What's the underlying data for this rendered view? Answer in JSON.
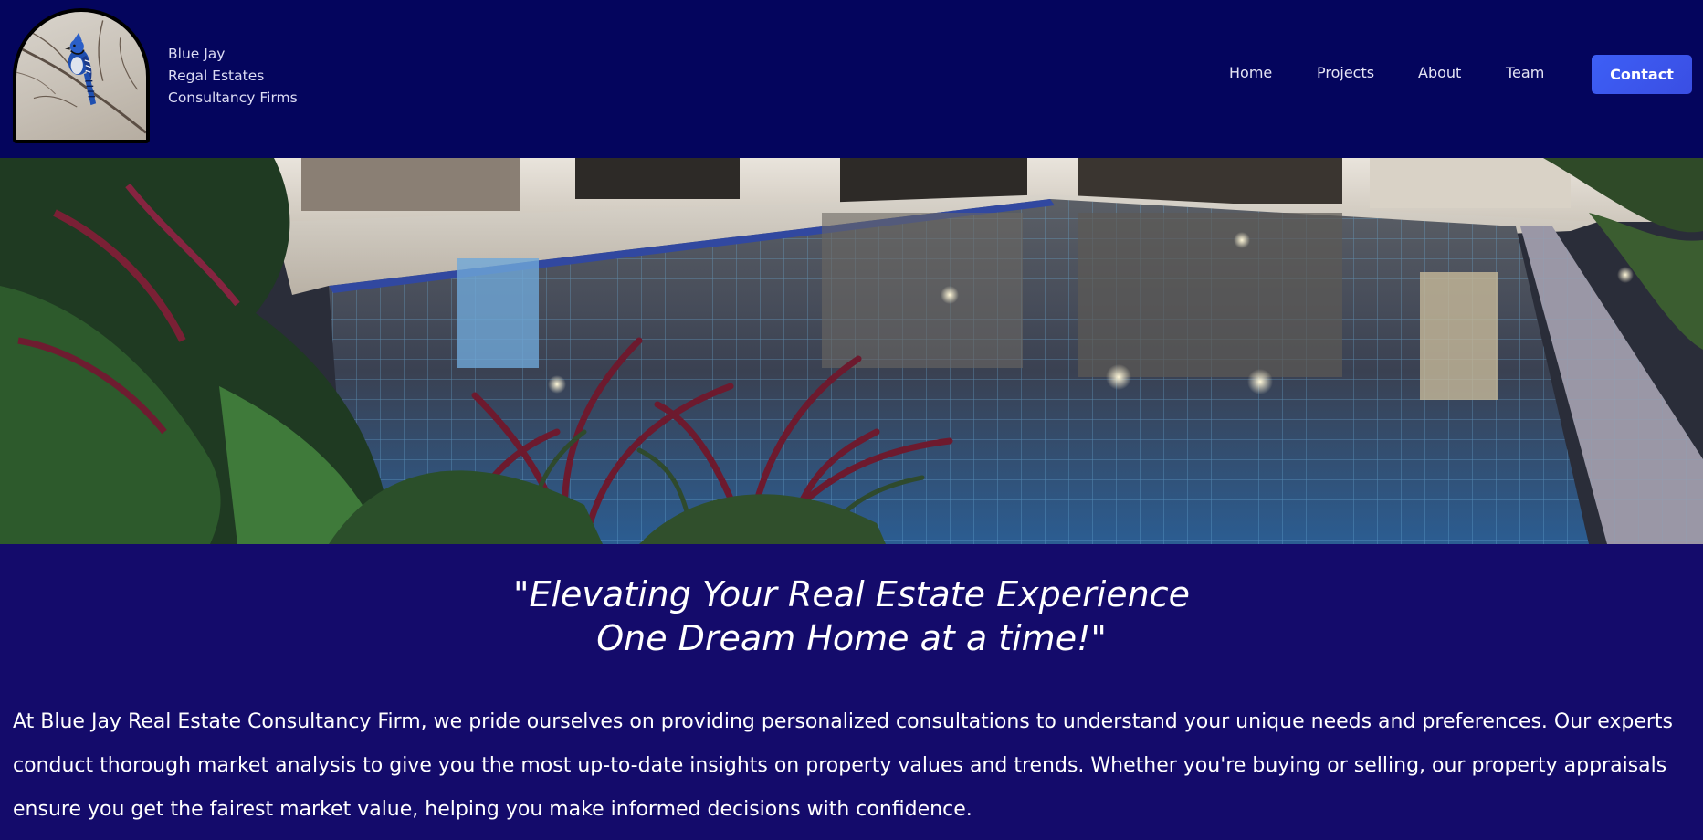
{
  "brand": {
    "line1": "Blue Jay",
    "line2": "Regal Estates",
    "line3": "Consultancy Firms",
    "logo_icon": "blue-jay-bird"
  },
  "nav": {
    "items": [
      {
        "label": "Home"
      },
      {
        "label": "Projects"
      },
      {
        "label": "About"
      },
      {
        "label": "Team"
      }
    ],
    "cta_label": "Contact"
  },
  "hero": {
    "image": "night view of modern house with illuminated swimming pool and tropical plants"
  },
  "tagline": {
    "line1": "\"Elevating Your Real Estate Experience",
    "line2": "One Dream Home at a time!\""
  },
  "description": "At Blue Jay Real Estate Consultancy Firm, we pride ourselves on providing personalized consultations to understand your unique needs and preferences. Our experts conduct thorough market analysis to give you the most up-to-date insights on property values and trends. Whether you're buying or selling, our property appraisals ensure you get the fairest market value, helping you make informed decisions with confidence.",
  "colors": {
    "header_bg": "#04055d",
    "content_bg": "#140b6b",
    "cta": "#3d5ff6"
  }
}
